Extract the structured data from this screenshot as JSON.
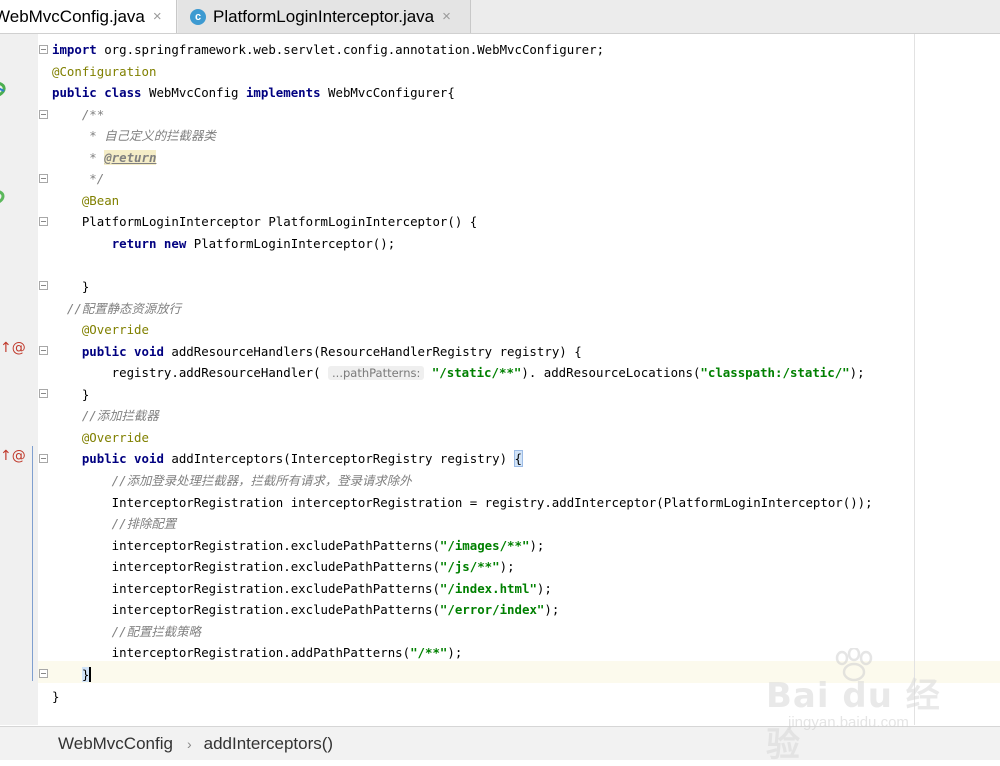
{
  "tabs": [
    {
      "label": "WebMvcConfig.java",
      "close": "×"
    },
    {
      "label": "PlatformLoginInterceptor.java",
      "icon": "c",
      "close": "×"
    }
  ],
  "code": [
    {
      "segs": [
        [
          "kw",
          "import"
        ],
        [
          "n",
          " org.springframework.web.servlet.config.annotation.WebMvcConfigurer;"
        ]
      ]
    },
    {
      "segs": [
        [
          "ann",
          "@Configuration"
        ]
      ]
    },
    {
      "segs": [
        [
          "kw",
          "public class"
        ],
        [
          "n",
          " WebMvcConfig "
        ],
        [
          "kw",
          "implements"
        ],
        [
          "n",
          " WebMvcConfigurer{"
        ]
      ]
    },
    {
      "segs": [
        [
          "cmt",
          "    /**"
        ]
      ]
    },
    {
      "segs": [
        [
          "cmt",
          "     * 自己定义的拦截器类"
        ]
      ]
    },
    {
      "segs": [
        [
          "cmt",
          "     * "
        ],
        [
          "doctag",
          "@return"
        ]
      ]
    },
    {
      "segs": [
        [
          "cmt",
          "     */"
        ]
      ]
    },
    {
      "segs": [
        [
          "ann",
          "    @Bean"
        ]
      ]
    },
    {
      "segs": [
        [
          "n",
          "    PlatformLoginInterceptor PlatformLoginInterceptor() {"
        ]
      ]
    },
    {
      "segs": [
        [
          "n",
          "        "
        ],
        [
          "kw",
          "return new"
        ],
        [
          "n",
          " PlatformLoginInterceptor();"
        ]
      ]
    },
    {
      "segs": [
        [
          "n",
          ""
        ]
      ]
    },
    {
      "segs": [
        [
          "n",
          "    }"
        ]
      ]
    },
    {
      "segs": [
        [
          "cmt",
          "  //配置静态资源放行"
        ]
      ]
    },
    {
      "segs": [
        [
          "ann",
          "    @Override"
        ]
      ]
    },
    {
      "segs": [
        [
          "n",
          "    "
        ],
        [
          "kw",
          "public void"
        ],
        [
          "n",
          " addResourceHandlers(ResourceHandlerRegistry registry) {"
        ]
      ]
    },
    {
      "segs": [
        [
          "n",
          "        registry.addResourceHandler( "
        ],
        [
          "hint",
          "...pathPatterns:"
        ],
        [
          "n",
          " "
        ],
        [
          "str",
          "\"/static/**\""
        ],
        [
          "n",
          "). addResourceLocations("
        ],
        [
          "str",
          "\"classpath:/static/\""
        ],
        [
          "n",
          ");"
        ]
      ]
    },
    {
      "segs": [
        [
          "n",
          "    }"
        ]
      ]
    },
    {
      "segs": [
        [
          "cmt",
          "    //添加拦截器"
        ]
      ]
    },
    {
      "segs": [
        [
          "ann",
          "    @Override"
        ]
      ]
    },
    {
      "segs": [
        [
          "n",
          "    "
        ],
        [
          "kw",
          "public void"
        ],
        [
          "n",
          " addInterceptors(InterceptorRegistry registry) "
        ],
        [
          "bhl",
          "{"
        ]
      ]
    },
    {
      "segs": [
        [
          "cmt",
          "        //添加登录处理拦截器，拦截所有请求，登录请求除外"
        ]
      ]
    },
    {
      "segs": [
        [
          "n",
          "        InterceptorRegistration interceptorRegistration = registry.addInterceptor(PlatformLoginInterceptor());"
        ]
      ]
    },
    {
      "segs": [
        [
          "cmt",
          "        //排除配置"
        ]
      ]
    },
    {
      "segs": [
        [
          "n",
          "        interceptorRegistration.excludePathPatterns("
        ],
        [
          "str",
          "\"/images/**\""
        ],
        [
          "n",
          ");"
        ]
      ]
    },
    {
      "segs": [
        [
          "n",
          "        interceptorRegistration.excludePathPatterns("
        ],
        [
          "str",
          "\"/js/**\""
        ],
        [
          "n",
          ");"
        ]
      ]
    },
    {
      "segs": [
        [
          "n",
          "        interceptorRegistration.excludePathPatterns("
        ],
        [
          "str",
          "\"/index.html\""
        ],
        [
          "n",
          ");"
        ]
      ]
    },
    {
      "segs": [
        [
          "n",
          "        interceptorRegistration.excludePathPatterns("
        ],
        [
          "str",
          "\"/error/index\""
        ],
        [
          "n",
          ");"
        ]
      ]
    },
    {
      "segs": [
        [
          "cmt",
          "        //配置拦截策略"
        ]
      ]
    },
    {
      "segs": [
        [
          "n",
          "        interceptorRegistration.addPathPatterns("
        ],
        [
          "str",
          "\"/**\""
        ],
        [
          "n",
          ");"
        ]
      ]
    },
    {
      "segs": [
        [
          "n",
          "    "
        ],
        [
          "caret",
          "}"
        ]
      ]
    },
    {
      "segs": [
        [
          "n",
          "}"
        ]
      ]
    }
  ],
  "gutter_marks": {
    "override": "↑@"
  },
  "breadcrumb": {
    "class_name": "WebMvcConfig",
    "separator": "›",
    "method": "addInterceptors()"
  },
  "watermark": {
    "logo": "Bai du 经验",
    "url": "jingyan.baidu.com"
  },
  "colors": {
    "keyword": "#000080",
    "annotation": "#808000",
    "comment": "#808080",
    "string": "#008000"
  }
}
